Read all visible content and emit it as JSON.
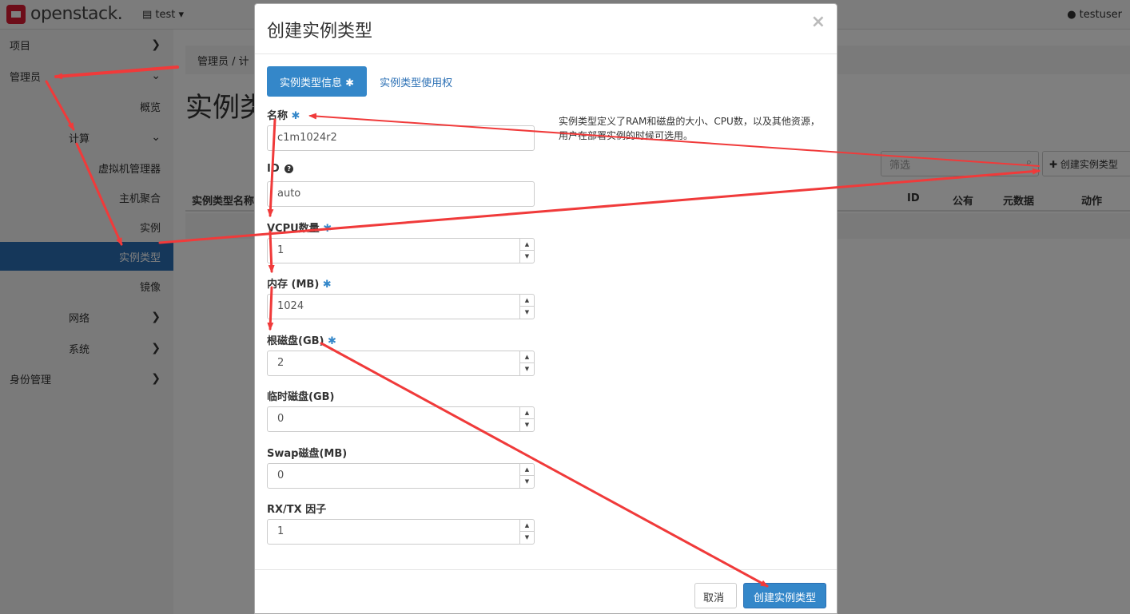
{
  "app": {
    "logo": "openstack.",
    "project": "test ▾",
    "user": "testuser"
  },
  "sidebar": {
    "items": [
      {
        "label": "项目"
      },
      {
        "label": "管理员"
      },
      {
        "label": "概览"
      },
      {
        "label": "计算"
      },
      {
        "label": "虚拟机管理器"
      },
      {
        "label": "主机聚合"
      },
      {
        "label": "实例"
      },
      {
        "label": "实例类型"
      },
      {
        "label": "镜像"
      },
      {
        "label": "网络"
      },
      {
        "label": "系统"
      },
      {
        "label": "身份管理"
      }
    ]
  },
  "main": {
    "breadcrumb": "管理员 /  计",
    "title": "实例类",
    "filter_placeholder": "筛选",
    "create_button": "创建实例类型",
    "columns": [
      "实例类型名称",
      "ID",
      "公有",
      "元数据",
      "动作"
    ]
  },
  "modal": {
    "title": "创建实例类型",
    "close": "×",
    "tabs": [
      "实例类型信息",
      "实例类型使用权"
    ],
    "required_mark": "✱",
    "description": "实例类型定义了RAM和磁盘的大小、CPU数，以及其他资源，用户在部署实例的时候可选用。",
    "fields": {
      "name": {
        "label": "名称",
        "value": "c1m1024r2"
      },
      "id": {
        "label": "ID",
        "value": "auto"
      },
      "vcpu": {
        "label": "VCPU数量",
        "value": "1"
      },
      "ram": {
        "label": "内存 (MB)",
        "value": "1024"
      },
      "disk": {
        "label": "根磁盘(GB)",
        "value": "2"
      },
      "ephemeral": {
        "label": "临时磁盘(GB)",
        "value": "0"
      },
      "swap": {
        "label": "Swap磁盘(MB)",
        "value": "0"
      },
      "rxtx": {
        "label": "RX/TX 因子",
        "value": "1"
      }
    },
    "cancel": "取消",
    "submit": "创建实例类型"
  },
  "colors": {
    "accent": "#3487c9",
    "arrow": "#f03a3a",
    "active_nav": "#2a6fb4"
  }
}
